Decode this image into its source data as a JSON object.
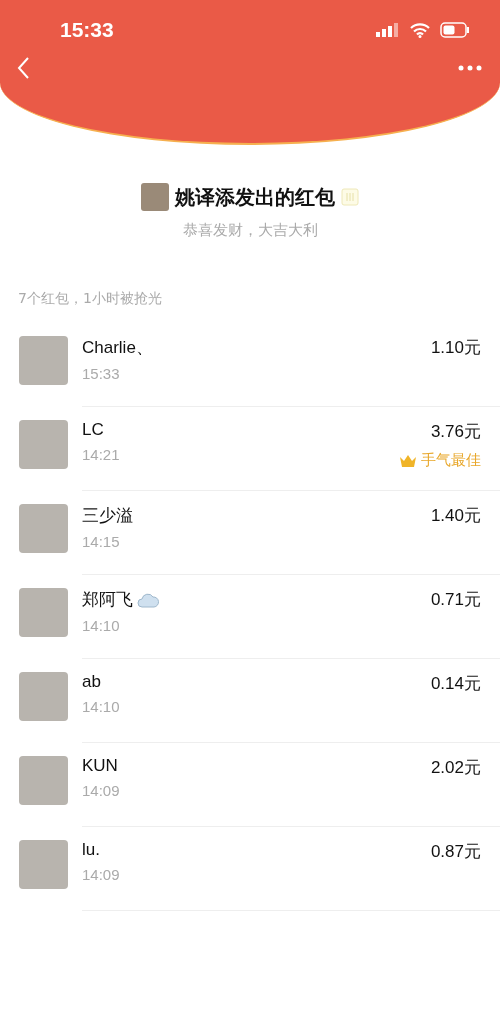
{
  "status_bar": {
    "time": "15:33"
  },
  "header": {
    "title": "姚译添发出的红包",
    "greeting": "恭喜发财，大吉大利"
  },
  "summary": "7个红包，1小时被抢光",
  "best_label": "手气最佳",
  "rows": [
    {
      "name": "Charlie、",
      "time": "15:33",
      "amount": "1.10元",
      "best": false,
      "sticker": false
    },
    {
      "name": "LC",
      "time": "14:21",
      "amount": "3.76元",
      "best": true,
      "sticker": false
    },
    {
      "name": "三少溢",
      "time": "14:15",
      "amount": "1.40元",
      "best": false,
      "sticker": false
    },
    {
      "name": "郑阿飞",
      "time": "14:10",
      "amount": "0.71元",
      "best": false,
      "sticker": true
    },
    {
      "name": "ab",
      "time": "14:10",
      "amount": "0.14元",
      "best": false,
      "sticker": false
    },
    {
      "name": "KUN",
      "time": "14:09",
      "amount": "2.02元",
      "best": false,
      "sticker": false
    },
    {
      "name": "lu.",
      "time": "14:09",
      "amount": "0.87元",
      "best": false,
      "sticker": false
    }
  ]
}
